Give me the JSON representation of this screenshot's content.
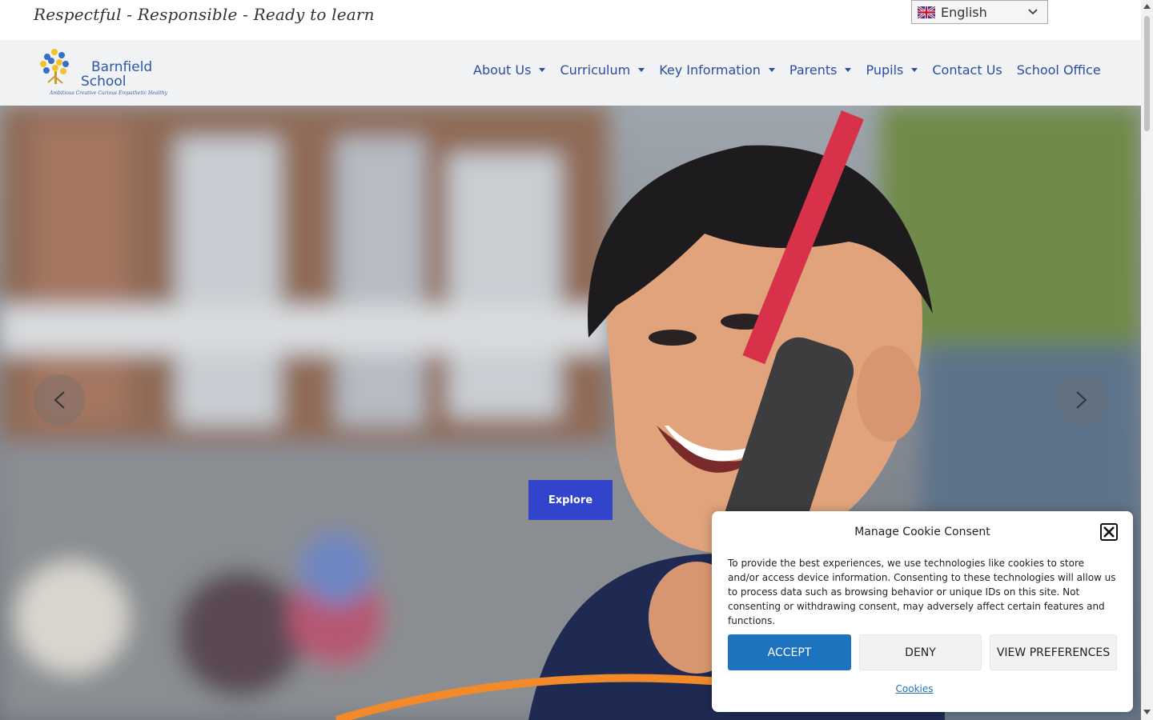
{
  "topbar": {
    "tagline": "Respectful - Responsible - Ready to learn",
    "language": {
      "selected": "English",
      "icon": "uk-flag-icon"
    }
  },
  "header": {
    "logo": {
      "line1": "Barnfield",
      "line2": "School",
      "motto": "Ambitious Creative Curious Empathetic Healthy"
    },
    "nav": [
      {
        "label": "About Us",
        "has_dropdown": true
      },
      {
        "label": "Curriculum",
        "has_dropdown": true
      },
      {
        "label": "Key Information",
        "has_dropdown": true
      },
      {
        "label": "Parents",
        "has_dropdown": true
      },
      {
        "label": "Pupils",
        "has_dropdown": true
      },
      {
        "label": "Contact Us",
        "has_dropdown": false
      },
      {
        "label": "School Office",
        "has_dropdown": false
      }
    ]
  },
  "hero": {
    "cta_label": "Explore",
    "prev_icon": "chevron-left-icon",
    "next_icon": "chevron-right-icon"
  },
  "cookie": {
    "title": "Manage Cookie Consent",
    "body": "To provide the best experiences, we use technologies like cookies to store and/or access device information. Consenting to these technologies will allow us to process data such as browsing behavior or unique IDs on this site. Not consenting or withdrawing consent, may adversely affect certain features and functions.",
    "accept_label": "ACCEPT",
    "deny_label": "DENY",
    "prefs_label": "VIEW PREFERENCES",
    "link_label": "Cookies"
  },
  "colors": {
    "nav_text": "#2c4da0",
    "cta": "#3344cc",
    "accept": "#1e73be"
  }
}
